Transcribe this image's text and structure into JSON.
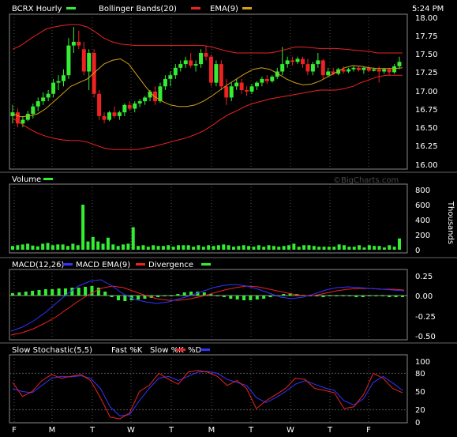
{
  "chart_data": [
    {
      "type": "candlestick",
      "legend": [
        {
          "label": "BCRX Hourly",
          "color": "#33ee33"
        },
        {
          "label": "Bollinger Bands(20)",
          "color": "#ee2222"
        },
        {
          "label": "EMA(9)",
          "color": "#d4a017"
        }
      ],
      "time": "5:24 PM",
      "ylim": [
        16.0,
        18.0
      ],
      "yticks": [
        "18.00",
        "17.75",
        "17.50",
        "17.25",
        "17.00",
        "16.75",
        "16.50",
        "16.25",
        "16.00"
      ],
      "candles": [
        [
          16.65,
          16.8,
          16.55,
          16.7
        ],
        [
          16.7,
          16.75,
          16.5,
          16.55
        ],
        [
          16.55,
          16.65,
          16.5,
          16.6
        ],
        [
          16.6,
          16.72,
          16.58,
          16.68
        ],
        [
          16.68,
          16.82,
          16.62,
          16.78
        ],
        [
          16.78,
          16.9,
          16.72,
          16.85
        ],
        [
          16.85,
          16.97,
          16.8,
          16.9
        ],
        [
          16.9,
          17.0,
          16.85,
          16.95
        ],
        [
          16.95,
          17.15,
          16.9,
          17.1
        ],
        [
          17.1,
          17.2,
          17.0,
          17.12
        ],
        [
          17.12,
          17.28,
          17.05,
          17.2
        ],
        [
          17.2,
          17.7,
          17.15,
          17.6
        ],
        [
          17.6,
          17.85,
          17.5,
          17.65
        ],
        [
          17.65,
          17.8,
          17.55,
          17.6
        ],
        [
          17.55,
          17.65,
          17.2,
          17.25
        ],
        [
          17.25,
          17.55,
          17.0,
          17.5
        ],
        [
          17.5,
          17.55,
          16.9,
          16.95
        ],
        [
          16.95,
          17.0,
          16.6,
          16.65
        ],
        [
          16.65,
          16.7,
          16.55,
          16.6
        ],
        [
          16.6,
          16.72,
          16.58,
          16.7
        ],
        [
          16.7,
          16.78,
          16.62,
          16.65
        ],
        [
          16.65,
          16.72,
          16.6,
          16.7
        ],
        [
          16.7,
          16.82,
          16.65,
          16.8
        ],
        [
          16.8,
          16.85,
          16.72,
          16.75
        ],
        [
          16.75,
          16.85,
          16.7,
          16.82
        ],
        [
          16.82,
          16.88,
          16.77,
          16.85
        ],
        [
          16.85,
          16.92,
          16.8,
          16.9
        ],
        [
          16.9,
          17.0,
          16.85,
          16.98
        ],
        [
          16.98,
          17.05,
          16.8,
          16.85
        ],
        [
          16.85,
          17.1,
          16.83,
          17.05
        ],
        [
          17.05,
          17.2,
          17.0,
          17.15
        ],
        [
          17.15,
          17.25,
          17.05,
          17.2
        ],
        [
          17.2,
          17.35,
          17.15,
          17.3
        ],
        [
          17.3,
          17.4,
          17.25,
          17.35
        ],
        [
          17.35,
          17.45,
          17.3,
          17.4
        ],
        [
          17.4,
          17.5,
          17.3,
          17.33
        ],
        [
          17.33,
          17.4,
          17.25,
          17.35
        ],
        [
          17.35,
          17.55,
          17.3,
          17.5
        ],
        [
          17.5,
          17.6,
          17.4,
          17.45
        ],
        [
          17.45,
          17.48,
          17.05,
          17.1
        ],
        [
          17.1,
          17.4,
          17.05,
          17.35
        ],
        [
          17.35,
          17.4,
          17.0,
          17.05
        ],
        [
          17.05,
          17.15,
          16.8,
          16.9
        ],
        [
          16.9,
          17.1,
          16.85,
          17.05
        ],
        [
          17.05,
          17.15,
          17.0,
          17.1
        ],
        [
          17.1,
          17.15,
          16.95,
          17.0
        ],
        [
          17.0,
          17.05,
          16.92,
          16.98
        ],
        [
          16.98,
          17.08,
          16.95,
          17.05
        ],
        [
          17.05,
          17.12,
          17.0,
          17.1
        ],
        [
          17.1,
          17.18,
          17.05,
          17.15
        ],
        [
          17.15,
          17.2,
          17.08,
          17.12
        ],
        [
          17.12,
          17.2,
          17.1,
          17.18
        ],
        [
          17.18,
          17.3,
          17.15,
          17.25
        ],
        [
          17.25,
          17.58,
          17.2,
          17.35
        ],
        [
          17.35,
          17.45,
          17.3,
          17.4
        ],
        [
          17.4,
          17.45,
          17.33,
          17.38
        ],
        [
          17.38,
          17.45,
          17.35,
          17.42
        ],
        [
          17.42,
          17.45,
          17.3,
          17.35
        ],
        [
          17.35,
          17.42,
          17.2,
          17.25
        ],
        [
          17.25,
          17.38,
          17.2,
          17.35
        ],
        [
          17.35,
          17.5,
          17.3,
          17.4
        ],
        [
          17.4,
          17.42,
          17.15,
          17.2
        ],
        [
          17.2,
          17.3,
          17.18,
          17.25
        ],
        [
          17.25,
          17.3,
          17.2,
          17.22
        ],
        [
          17.22,
          17.3,
          17.2,
          17.28
        ],
        [
          17.28,
          17.32,
          17.22,
          17.25
        ],
        [
          17.25,
          17.3,
          17.23,
          17.28
        ],
        [
          17.28,
          17.33,
          17.25,
          17.3
        ],
        [
          17.3,
          17.32,
          17.25,
          17.27
        ],
        [
          17.27,
          17.32,
          17.22,
          17.3
        ],
        [
          17.3,
          17.32,
          17.24,
          17.26
        ],
        [
          17.26,
          17.3,
          17.25,
          17.28
        ],
        [
          17.28,
          17.32,
          17.1,
          17.25
        ],
        [
          17.25,
          17.3,
          17.22,
          17.28
        ],
        [
          17.28,
          17.3,
          17.2,
          17.24
        ],
        [
          17.24,
          17.35,
          17.22,
          17.32
        ],
        [
          17.32,
          17.45,
          17.28,
          17.38
        ]
      ],
      "bollinger_upper": [
        17.55,
        17.6,
        17.68,
        17.75,
        17.82,
        17.85,
        17.87,
        17.88,
        17.88,
        17.85,
        17.78,
        17.7,
        17.65,
        17.62,
        17.61,
        17.6,
        17.6,
        17.6,
        17.6,
        17.6,
        17.6,
        17.6,
        17.6,
        17.6,
        17.58,
        17.55,
        17.52,
        17.5,
        17.5,
        17.5,
        17.5,
        17.5,
        17.52,
        17.55,
        17.58,
        17.58,
        17.57,
        17.56,
        17.56,
        17.56,
        17.55,
        17.54,
        17.53,
        17.52,
        17.5,
        17.5,
        17.5,
        17.5
      ],
      "bollinger_lower": [
        16.62,
        16.55,
        16.48,
        16.42,
        16.38,
        16.35,
        16.33,
        16.32,
        16.32,
        16.3,
        16.26,
        16.22,
        16.2,
        16.2,
        16.2,
        16.2,
        16.22,
        16.24,
        16.27,
        16.3,
        16.33,
        16.36,
        16.4,
        16.45,
        16.52,
        16.6,
        16.67,
        16.72,
        16.78,
        16.82,
        16.85,
        16.88,
        16.9,
        16.92,
        16.94,
        16.96,
        16.98,
        17.0,
        17.0,
        17.0,
        17.02,
        17.05,
        17.1,
        17.14,
        17.18,
        17.2,
        17.2,
        17.2
      ],
      "ema9": [
        16.68,
        16.64,
        16.65,
        16.68,
        16.75,
        16.85,
        16.95,
        17.05,
        17.1,
        17.15,
        17.25,
        17.35,
        17.4,
        17.42,
        17.35,
        17.2,
        17.05,
        16.92,
        16.85,
        16.8,
        16.78,
        16.78,
        16.8,
        16.85,
        16.92,
        17.0,
        17.08,
        17.15,
        17.22,
        17.28,
        17.3,
        17.28,
        17.22,
        17.15,
        17.1,
        17.07,
        17.08,
        17.12,
        17.18,
        17.24,
        17.3,
        17.33,
        17.32,
        17.3,
        17.29,
        17.29,
        17.29,
        17.3
      ]
    },
    {
      "type": "bar",
      "title": "Volume",
      "legend_color": "#33ee33",
      "ylabel": "Thousands",
      "ylim": [
        0,
        800
      ],
      "yticks": [
        "800",
        "600",
        "400",
        "200",
        "0"
      ],
      "values": [
        50,
        60,
        70,
        80,
        55,
        45,
        80,
        90,
        60,
        70,
        70,
        50,
        80,
        60,
        600,
        110,
        170,
        110,
        80,
        160,
        70,
        50,
        70,
        80,
        300,
        50,
        60,
        40,
        60,
        50,
        50,
        60,
        40,
        60,
        60,
        60,
        40,
        60,
        40,
        60,
        50,
        60,
        70,
        60,
        40,
        50,
        60,
        50,
        40,
        60,
        40,
        60,
        50,
        40,
        50,
        60,
        80,
        40,
        60,
        60,
        50,
        40,
        40,
        40,
        40,
        70,
        60,
        40,
        40,
        60,
        30,
        60,
        50,
        50,
        30,
        60,
        40,
        150
      ]
    },
    {
      "type": "line",
      "legend": [
        {
          "label": "MACD(12,26)",
          "color": "#3333ff"
        },
        {
          "label": "MACD EMA(9)",
          "color": "#ee2222"
        },
        {
          "label": "Divergence",
          "color": "#33ee33"
        }
      ],
      "ylim": [
        -0.6,
        0.3
      ],
      "yticks": [
        "0.25",
        "0.00",
        "-0.25",
        "-0.50"
      ],
      "macd": [
        -0.45,
        -0.4,
        -0.32,
        -0.22,
        -0.1,
        0.02,
        0.12,
        0.18,
        0.2,
        0.12,
        0.02,
        -0.05,
        -0.08,
        -0.1,
        -0.08,
        -0.04,
        0.0,
        0.05,
        0.1,
        0.13,
        0.14,
        0.12,
        0.08,
        0.03,
        -0.02,
        -0.04,
        -0.02,
        0.02,
        0.07,
        0.1,
        0.11,
        0.1,
        0.09,
        0.08,
        0.07,
        0.06
      ],
      "signal": [
        -0.5,
        -0.47,
        -0.42,
        -0.35,
        -0.27,
        -0.17,
        -0.07,
        0.02,
        0.09,
        0.12,
        0.1,
        0.05,
        0.0,
        -0.04,
        -0.06,
        -0.06,
        -0.04,
        -0.01,
        0.03,
        0.07,
        0.1,
        0.12,
        0.11,
        0.08,
        0.05,
        0.02,
        0.0,
        0.0,
        0.03,
        0.06,
        0.08,
        0.09,
        0.09,
        0.08,
        0.08,
        0.07
      ],
      "divergence": [
        0.03,
        0.04,
        0.05,
        0.06,
        0.07,
        0.08,
        0.08,
        0.09,
        0.09,
        0.1,
        0.1,
        0.11,
        0.12,
        0.1,
        0.05,
        -0.02,
        -0.06,
        -0.07,
        -0.06,
        -0.05,
        -0.04,
        -0.03,
        -0.02,
        -0.01,
        0.0,
        0.02,
        0.04,
        0.05,
        0.05,
        0.04,
        0.02,
        0.0,
        -0.02,
        -0.04,
        -0.05,
        -0.06,
        -0.06,
        -0.05,
        -0.04,
        -0.02,
        0.0,
        0.02,
        0.03,
        0.02,
        0.01,
        0.0,
        -0.01,
        -0.02,
        -0.01,
        0.0,
        0.0,
        -0.01,
        -0.02,
        -0.02,
        -0.01,
        0.0,
        0.0,
        -0.02,
        -0.02,
        -0.02
      ]
    },
    {
      "type": "line",
      "legend": [
        {
          "label": "Slow Stochastic(5,5)",
          "color": "#ffffff"
        },
        {
          "label": "Fast %K",
          "color": "#ffffff"
        },
        {
          "label": "Slow %K",
          "color": "#ee2222"
        },
        {
          "label": "%D",
          "color": "#3333ff"
        }
      ],
      "ylim": [
        0,
        100
      ],
      "yticks": [
        "100",
        "80",
        "50",
        "20",
        "0"
      ],
      "x_labels": [
        "F",
        "M",
        "T",
        "W",
        "T",
        "M",
        "T",
        "W",
        "T",
        "F"
      ],
      "slow_k": [
        65,
        42,
        50,
        68,
        78,
        72,
        75,
        78,
        68,
        40,
        8,
        5,
        15,
        50,
        60,
        80,
        70,
        62,
        82,
        85,
        82,
        75,
        60,
        68,
        55,
        22,
        35,
        45,
        55,
        72,
        70,
        55,
        52,
        48,
        22,
        25,
        45,
        80,
        72,
        55,
        48
      ],
      "pct_d": [
        55,
        50,
        48,
        60,
        72,
        75,
        74,
        76,
        72,
        55,
        25,
        10,
        12,
        35,
        55,
        72,
        75,
        68,
        75,
        82,
        83,
        80,
        70,
        65,
        60,
        40,
        32,
        40,
        50,
        62,
        68,
        62,
        56,
        52,
        35,
        28,
        38,
        65,
        75,
        64,
        52
      ]
    }
  ],
  "watermark": "©BigCharts.com"
}
